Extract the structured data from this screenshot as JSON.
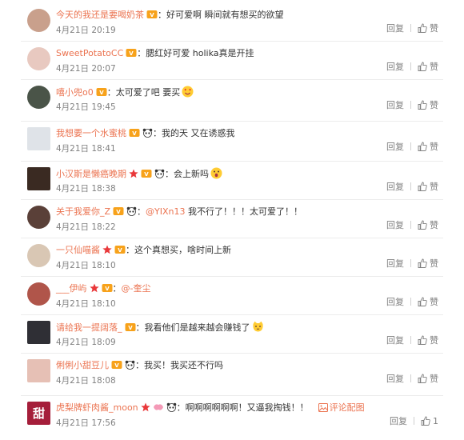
{
  "comments": [
    {
      "user": "今天的我还是要喝奶茶",
      "badges": [
        "vip"
      ],
      "text": "好可爱啊 瞬间就有想买的欲望",
      "time": "4月21日 20:19",
      "reply": "回复",
      "like": "赞"
    },
    {
      "user": "SweetPotatoCC",
      "badges": [
        "vip"
      ],
      "text": "腮红好可爱 holika真是开挂",
      "time": "4月21日 20:07",
      "reply": "回复",
      "like": "赞"
    },
    {
      "user": "嘻小兜o0",
      "badges": [
        "vip"
      ],
      "text": "太可爱了吧 要买",
      "emoji": "heart-eyes-emoji",
      "time": "4月21日 19:45",
      "reply": "回复",
      "like": "赞"
    },
    {
      "user": "我想要一个水蜜桃",
      "badges": [
        "vip",
        "panda"
      ],
      "text": "我的天 又在诱惑我",
      "time": "4月21日 18:41",
      "reply": "回复",
      "like": "赞"
    },
    {
      "user": "小汉斯是懒癌晚期",
      "badges": [
        "star",
        "vip",
        "panda"
      ],
      "text": "会上新吗",
      "emoji": "surprised-emoji",
      "time": "4月21日 18:38",
      "reply": "回复",
      "like": "赞"
    },
    {
      "user": "关于我爱你_Z",
      "badges": [
        "vip",
        "panda"
      ],
      "mention": "@YIXn13",
      "text": "我不行了！！！太可爱了！！",
      "time": "4月21日 18:22",
      "reply": "回复",
      "like": "赞"
    },
    {
      "user": "一只仙喵酱",
      "badges": [
        "star",
        "vip"
      ],
      "text": "这个真想买，啥时间上新",
      "time": "4月21日 18:10",
      "reply": "回复",
      "like": "赞"
    },
    {
      "user": "___伊屿",
      "badges": [
        "star",
        "vip"
      ],
      "mention": "@-奎尘",
      "text": "",
      "time": "4月21日 18:10",
      "reply": "回复",
      "like": "赞"
    },
    {
      "user": "请给我一提阔落_",
      "badges": [
        "vip"
      ],
      "text": "我看他们是越来越会赚钱了",
      "emoji": "cat-emoji",
      "time": "4月21日 18:09",
      "reply": "回复",
      "like": "赞"
    },
    {
      "user": "俐俐小甜豆儿",
      "badges": [
        "vip",
        "panda"
      ],
      "text": "我买！我买还不行吗",
      "time": "4月21日 18:08",
      "reply": "回复",
      "like": "赞"
    },
    {
      "user": "虎梨牌虾肉酱_moon",
      "badges": [
        "star",
        "pink",
        "panda"
      ],
      "text": "啊啊啊啊啊啊！又逼我掏钱！！",
      "time": "4月21日 17:56",
      "reply": "回复",
      "like": "1",
      "pic": "评论配图",
      "avatar_text": "甜"
    }
  ],
  "colors": {
    "username": "#eb7350",
    "meta": "#808080",
    "divider": "#ececec"
  }
}
